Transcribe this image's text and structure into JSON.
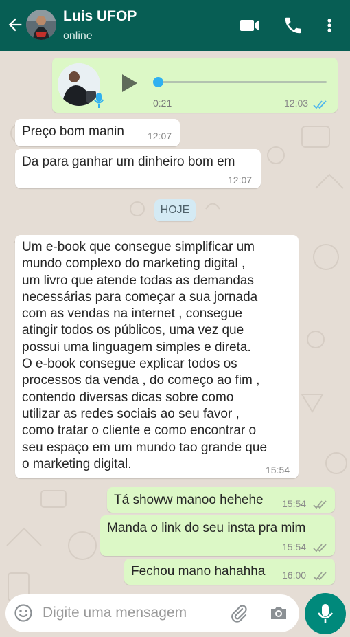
{
  "header": {
    "contact_name": "Luis UFOP",
    "status": "online"
  },
  "icons": {
    "back": "arrow-left-icon",
    "video": "video-call-icon",
    "call": "phone-icon",
    "menu": "more-vert-icon"
  },
  "colors": {
    "header": "#075e54",
    "wallpaper": "#e5ddd5",
    "incoming": "#ffffff",
    "outgoing": "#dcf8c6",
    "read_ticks": "#4fb6ec",
    "mic_button": "#00897b"
  },
  "messages": {
    "voice": {
      "duration": "0:21",
      "time": "12:03",
      "status": "read",
      "progress": 0.0
    },
    "m1": {
      "text": "Preço bom manin",
      "time": "12:07"
    },
    "m2": {
      "text": "Da para ganhar um dinheiro bom em",
      "time": "12:07"
    },
    "date_separator": "HOJE",
    "m3": {
      "lines": [
        "Um e-book que consegue simplificar um",
        "mundo complexo do marketing digital ,",
        "um livro que atende todas as demandas",
        "necessárias para começar a sua jornada",
        "com as vendas na internet , consegue",
        "atingir todos os públicos, uma vez que",
        "possui uma linguagem simples e direta.",
        "O e-book consegue explicar todos os",
        "processos da venda , do começo ao fim ,",
        "contendo diversas dicas sobre como",
        "utilizar as redes sociais ao seu favor ,",
        "como tratar o cliente e como encontrar o",
        "seu espaço em um mundo tao grande que",
        "o marketing digital."
      ],
      "time": "15:54"
    },
    "m4": {
      "text": "Tá showw manoo hehehe",
      "time": "15:54",
      "status": "delivered"
    },
    "m5": {
      "text": "Manda o link do seu insta pra mim",
      "time": "15:54",
      "status": "delivered"
    },
    "m6": {
      "text": "Fechou mano hahahha",
      "time": "16:00",
      "status": "delivered"
    }
  },
  "composer": {
    "placeholder": "Digite uma mensagem",
    "value": ""
  }
}
